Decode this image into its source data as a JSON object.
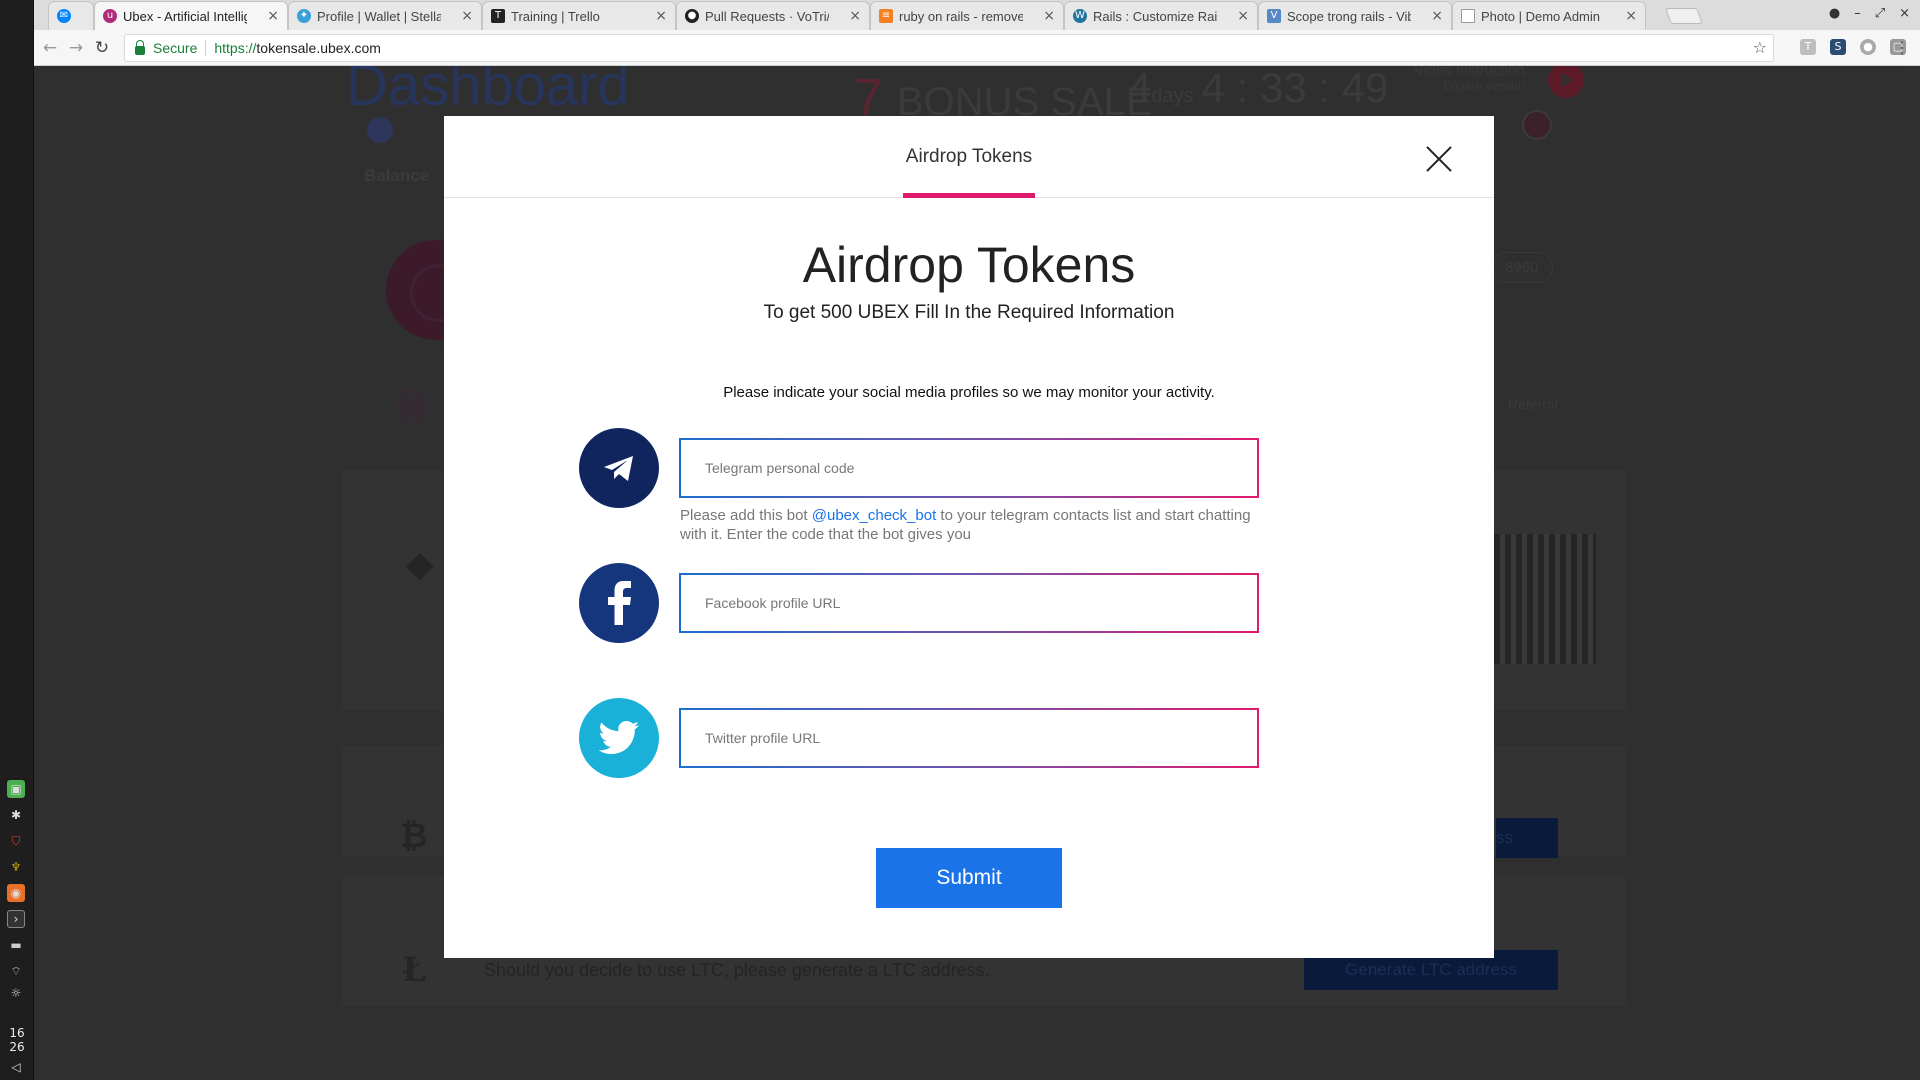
{
  "browser": {
    "tabs": [
      {
        "title": "",
        "icon": "messenger-icon",
        "color": "#0084ff"
      },
      {
        "title": "Ubex - Artificial Intellige",
        "icon": "ubex-icon",
        "color": "#b12a7a",
        "active": true
      },
      {
        "title": "Profile | Wallet | Stellar",
        "icon": "stellar-icon",
        "color": "#3aa0d8"
      },
      {
        "title": "Training | Trello",
        "icon": "trello-icon",
        "color": "#222"
      },
      {
        "title": "Pull Requests · VoTri/pro",
        "icon": "github-icon",
        "color": "#222"
      },
      {
        "title": "ruby on rails - remove a",
        "icon": "stackoverflow-icon",
        "color": "#f48024"
      },
      {
        "title": "Rails : Customize Rails A",
        "icon": "wordpress-icon",
        "color": "#21759b"
      },
      {
        "title": "Scope trong rails - Viblo",
        "icon": "viblo-icon",
        "color": "#5488c7"
      },
      {
        "title": "Photo | Demo Admin",
        "icon": "page-icon",
        "color": "#999"
      }
    ],
    "secure_label": "Secure",
    "url_scheme": "https://",
    "url_host": "tokensale.ubex.com"
  },
  "os": {
    "clock_hour": "16",
    "clock_minute": "26"
  },
  "background": {
    "dashboard_title": "Dashboard",
    "bonus_number": "7",
    "bonus_text": "BONUS SALE",
    "timer_days": "4",
    "timer_days_label": "days",
    "timer_time": "4 : 33 : 49",
    "video_instruction": "Video instruction",
    "video_sub": "English version",
    "balance_label": "Balance",
    "referral_label": "Referral",
    "account_number": "8960",
    "ltc_text": "Should you decide to use LTC, please generate a LTC address.",
    "ltc_button": "Generate LTC address",
    "btc_button": "ss"
  },
  "modal": {
    "tab_label": "Airdrop Tokens",
    "title": "Airdrop Tokens",
    "subtitle": "To get 500 UBEX Fill In the Required Information",
    "intro": "Please indicate your social media profiles so we may monitor your activity.",
    "fields": {
      "telegram_placeholder": "Telegram personal code",
      "facebook_placeholder": "Facebook profile URL",
      "twitter_placeholder": "Twitter profile URL"
    },
    "helper_before": "Please add this bot ",
    "helper_link": "@ubex_check_bot",
    "helper_after": " to your telegram contacts list and start chatting with it. Enter the code that the bot gives you",
    "submit_label": "Submit",
    "colors": {
      "accent_pink": "#e0196c",
      "submit_blue": "#1a73e8",
      "telegram": "#10245e",
      "facebook": "#15357d",
      "twitter": "#1ab1d8"
    }
  }
}
